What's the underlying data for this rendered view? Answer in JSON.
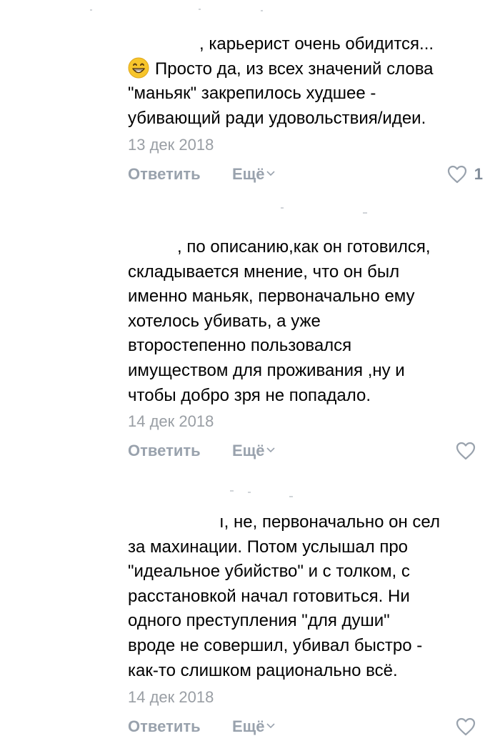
{
  "comments": [
    {
      "lines": [
        ", карьерист очень обидится...",
        "Просто да, из всех значений слова",
        "\"маньяк\" закрепилось худшее -",
        "убивающий ради удовольствия/идеи."
      ],
      "date": "13 дек 2018",
      "reply_label": "Ответить",
      "more_label": "Ещё",
      "likes": "1"
    },
    {
      "lines": [
        ", по описанию,как он готовился,",
        "складывается мнение, что он был",
        "именно маньяк, первоначально ему",
        "хотелось убивать, а уже",
        "второстепенно пользовался",
        "имуществом для проживания ,ну и",
        "чтобы добро зря не попадало."
      ],
      "date": "14 дек 2018",
      "reply_label": "Ответить",
      "more_label": "Ещё",
      "likes": ""
    },
    {
      "lines": [
        "ı, не, первоначально он сел",
        "за махинации. Потом услышал про",
        "\"идеальное убийство\" и с толком, с",
        "расстановкой начал готовиться. Ни",
        "одного преступления \"для души\"",
        "вроде не совершил, убивал быстро -",
        "как-то слишком рационально всё."
      ],
      "date": "14 дек 2018",
      "reply_label": "Ответить",
      "more_label": "Ещё",
      "likes": ""
    }
  ],
  "colors": {
    "text": "#000000",
    "date": "#999ea4",
    "action": "#99a2ad",
    "like_icon": "#99a2ad",
    "emoji_face": "#f7c52b"
  },
  "icons": {
    "emoji": "grinning-face-emoji",
    "like": "heart-outline-icon",
    "more": "chevron-down-icon"
  }
}
